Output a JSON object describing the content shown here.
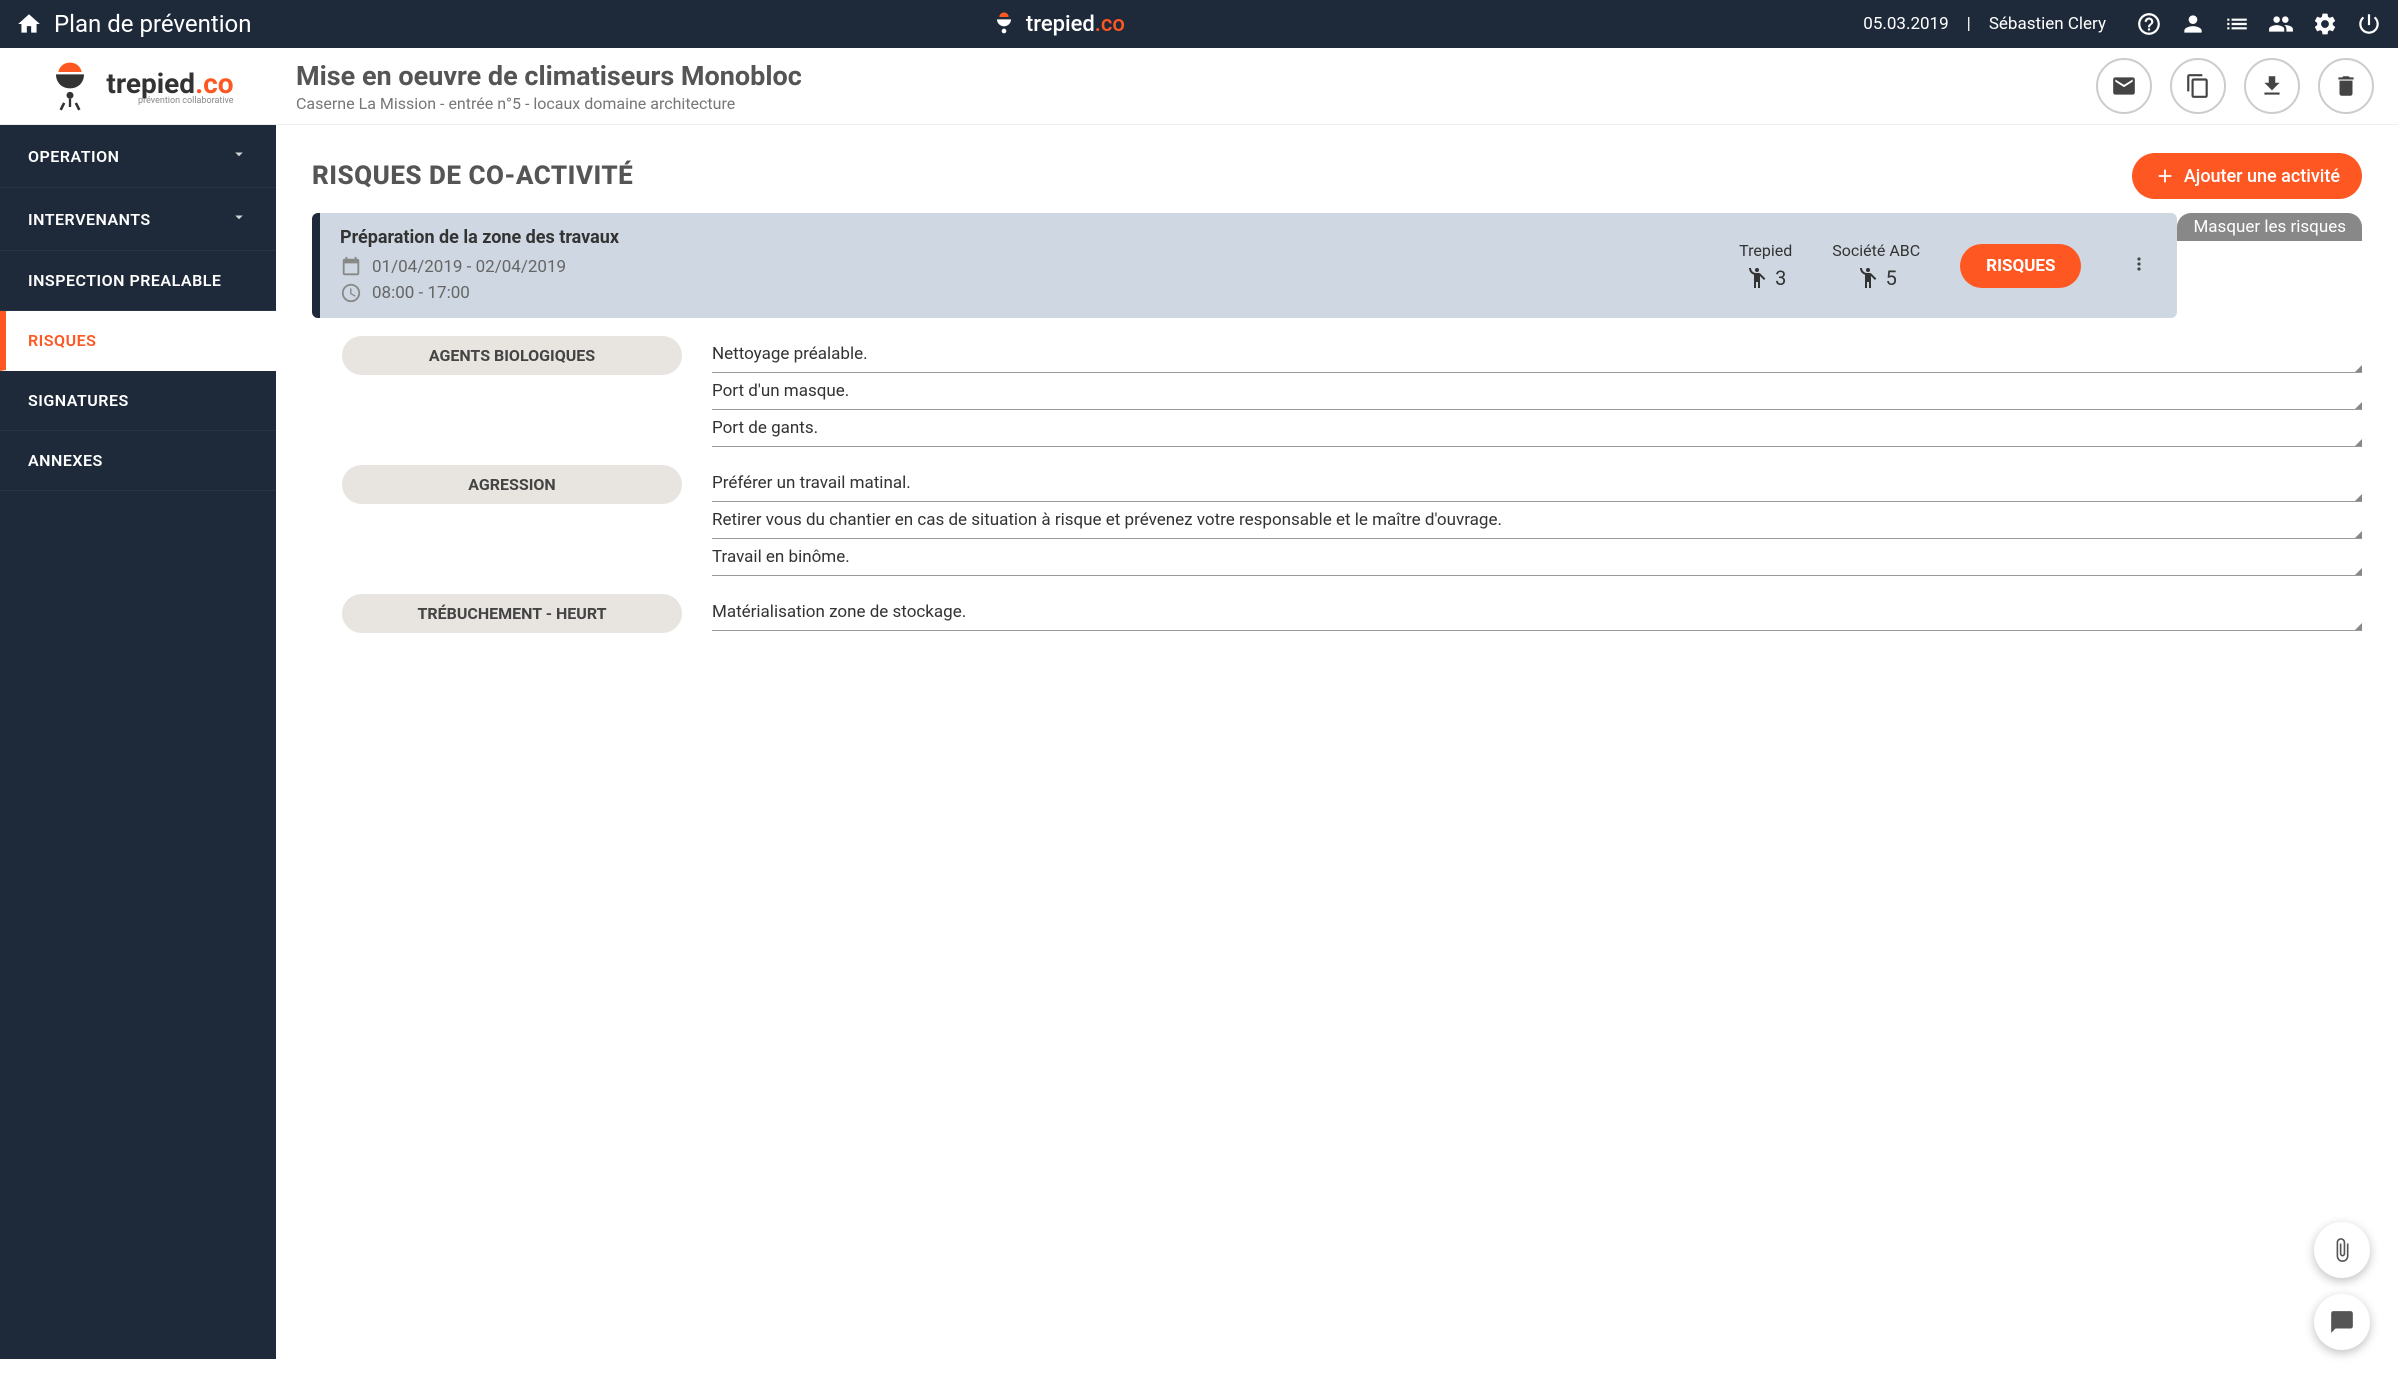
{
  "topbar": {
    "breadcrumb": "Plan de prévention",
    "brand_part1": "trepied",
    "brand_part2": ".co",
    "date": "05.03.2019",
    "separator": "|",
    "user": "Sébastien Clery"
  },
  "header": {
    "brand_part1": "trepied",
    "brand_part2": ".co",
    "brand_tagline": "prévention collaborative",
    "project_title": "Mise en oeuvre de climatiseurs Monobloc",
    "project_subtitle": "Caserne La Mission - entrée n°5 - locaux domaine architecture"
  },
  "sidebar": {
    "items": [
      {
        "label": "OPERATION",
        "expandable": true
      },
      {
        "label": "INTERVENANTS",
        "expandable": true
      },
      {
        "label": "INSPECTION PREALABLE",
        "expandable": false
      },
      {
        "label": "RISQUES",
        "expandable": false,
        "active": true
      },
      {
        "label": "SIGNATURES",
        "expandable": false
      },
      {
        "label": "ANNEXES",
        "expandable": false
      }
    ]
  },
  "page": {
    "title": "RISQUES DE CO-ACTIVITÉ",
    "add_button": "Ajouter une activité",
    "hide_risks": "Masquer les risques"
  },
  "activity": {
    "title": "Préparation de la zone des travaux",
    "date_range": "01/04/2019 - 02/04/2019",
    "time_range": "08:00 - 17:00",
    "companies": [
      {
        "name": "Trepied",
        "count": "3"
      },
      {
        "name": "Société ABC",
        "count": "5"
      }
    ],
    "risques_btn": "RISQUES"
  },
  "risks": [
    {
      "category": "AGENTS BIOLOGIQUES",
      "measures": [
        "Nettoyage préalable.",
        "Port d'un masque.",
        "Port de gants."
      ]
    },
    {
      "category": "AGRESSION",
      "measures": [
        "Préférer un travail matinal.",
        "Retirer vous du chantier en cas de situation à risque et prévenez votre responsable et le maître d'ouvrage.",
        "Travail en binôme."
      ]
    },
    {
      "category": "TRÉBUCHEMENT - HEURT",
      "measures": [
        "Matérialisation zone de stockage."
      ]
    }
  ]
}
